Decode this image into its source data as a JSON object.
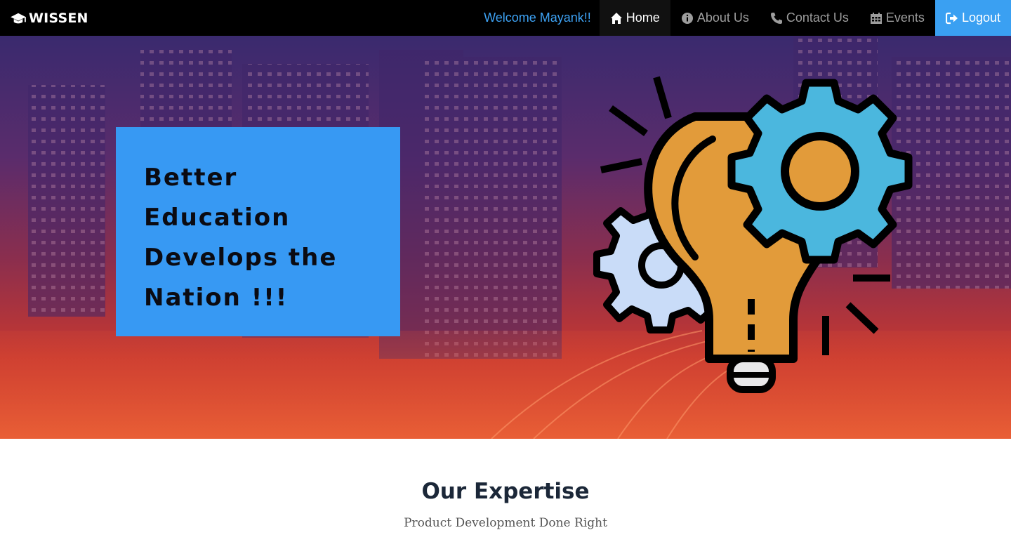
{
  "navbar": {
    "brand": "WISSEN",
    "welcome": "Welcome Mayank!!",
    "items": [
      {
        "label": "Home",
        "icon": "home-icon"
      },
      {
        "label": "About Us",
        "icon": "info-icon"
      },
      {
        "label": "Contact Us",
        "icon": "phone-icon"
      },
      {
        "label": "Events",
        "icon": "calendar-icon"
      },
      {
        "label": "Logout",
        "icon": "logout-icon"
      }
    ]
  },
  "hero": {
    "quote": "Better\nEducation\nDevelops the\nNation !!!",
    "illustration": "lightbulb-gears-icon"
  },
  "expertise": {
    "title": "Our Expertise",
    "subtitle": "Product Development Done Right"
  },
  "colors": {
    "navbar_bg": "#000000",
    "accent_blue": "#3799f3",
    "welcome_text": "#3ea3f5",
    "logout_bg": "#3aa0f2"
  }
}
